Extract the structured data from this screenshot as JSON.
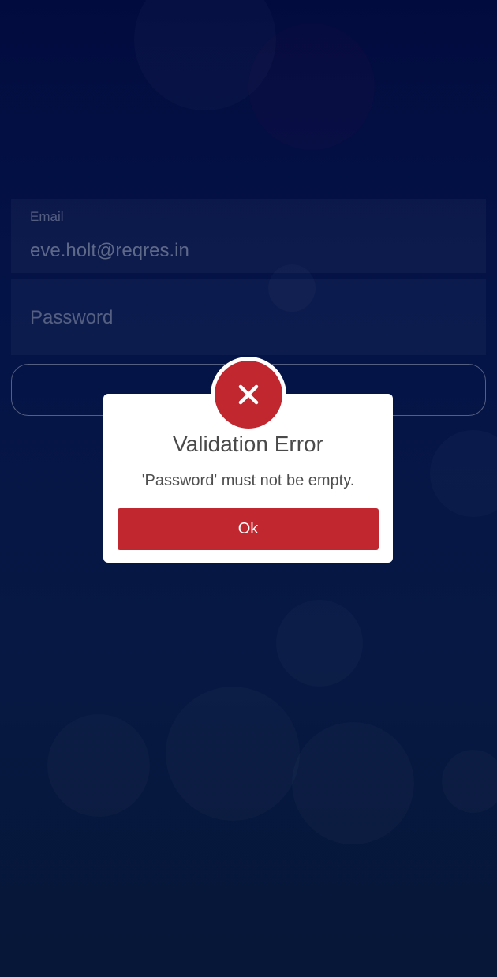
{
  "login_form": {
    "email": {
      "label": "Email",
      "value": "eve.holt@reqres.in"
    },
    "password": {
      "placeholder": "Password"
    }
  },
  "alert": {
    "icon": "close-icon",
    "title": "Validation Error",
    "message": "'Password' must not be empty.",
    "ok_label": "Ok",
    "accent_color": "#c0272f"
  }
}
